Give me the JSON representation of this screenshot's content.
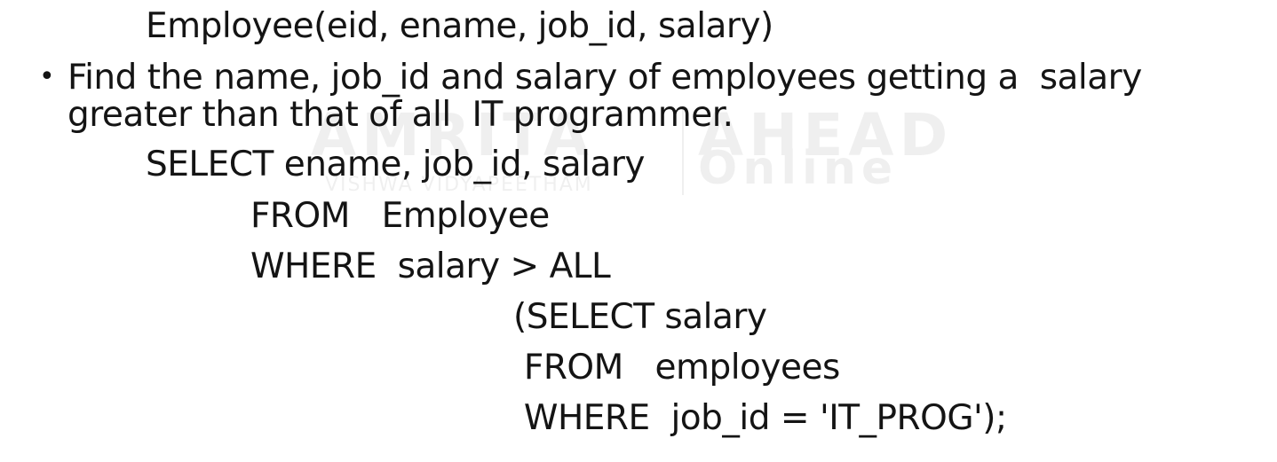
{
  "watermark": {
    "left_brand": "AMRITA",
    "left_sub": "VISHWA VIDYAPEETHAM",
    "right_brand": "AHEAD",
    "right_sub": "Online"
  },
  "schema_line": "Employee(eid, ename, job_id, salary)",
  "bullet_symbol": "•",
  "question_lines": [
    "Find the name, job_id and salary of employees getting a  salary",
    "greater than that of all  IT programmer."
  ],
  "query_lines": [
    "SELECT ename, job_id, salary",
    "FROM   Employee",
    "WHERE  salary > ALL",
    "(SELECT salary",
    " FROM   employees",
    " WHERE  job_id = 'IT_PROG');"
  ]
}
